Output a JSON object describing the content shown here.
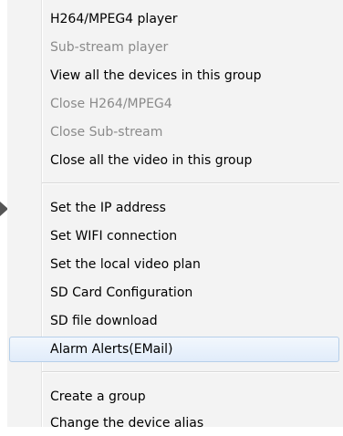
{
  "menu": {
    "groups": [
      {
        "items": [
          {
            "label": "H264/MPEG4 player",
            "enabled": true
          },
          {
            "label": "Sub-stream player",
            "enabled": false
          },
          {
            "label": "View all the devices in this group",
            "enabled": true
          },
          {
            "label": "Close H264/MPEG4",
            "enabled": false
          },
          {
            "label": "Close Sub-stream",
            "enabled": false
          },
          {
            "label": "Close all the video in this group",
            "enabled": true
          }
        ]
      },
      {
        "items": [
          {
            "label": "Set the IP address",
            "enabled": true
          },
          {
            "label": "Set WIFI connection",
            "enabled": true
          },
          {
            "label": "Set the local video plan",
            "enabled": true
          },
          {
            "label": "SD Card Configuration",
            "enabled": true
          },
          {
            "label": "SD file download",
            "enabled": true
          },
          {
            "label": "Alarm Alerts(EMail)",
            "enabled": true,
            "highlighted": true
          }
        ]
      },
      {
        "items": [
          {
            "label": "Create a group",
            "enabled": true
          },
          {
            "label": "Change the device alias",
            "enabled": true
          }
        ]
      }
    ]
  },
  "colors": {
    "menu_background": "#f3f3f3",
    "disabled_text": "#8a8a8a",
    "highlight_border": "#b6cfe9"
  }
}
